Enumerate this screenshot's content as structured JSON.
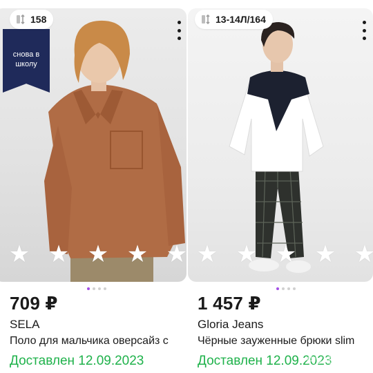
{
  "cards": [
    {
      "size_label": "158",
      "promo_badge": "снова в школу",
      "price": "709 ₽",
      "brand": "SELA",
      "title": "Поло для мальчика оверсайз с",
      "delivered": "Доставлен 12.09.2023",
      "rating_stars": 5,
      "photo_count": 4,
      "active_photo": 1
    },
    {
      "size_label": "13-14Л/164",
      "price": "1 457 ₽",
      "brand": "Gloria Jeans",
      "title": "Чёрные зауженные брюки slim",
      "delivered": "Доставлен 12.09.2023",
      "rating_stars": 5,
      "photo_count": 4,
      "active_photo": 1
    }
  ],
  "watermark": "Avito",
  "colors": {
    "accent_purple": "#a44ee6",
    "delivered_green": "#1fb24b",
    "promo_navy": "#1f2a5a"
  },
  "icons": [
    "size-chart-icon",
    "more-vertical-icon",
    "star-icon"
  ]
}
